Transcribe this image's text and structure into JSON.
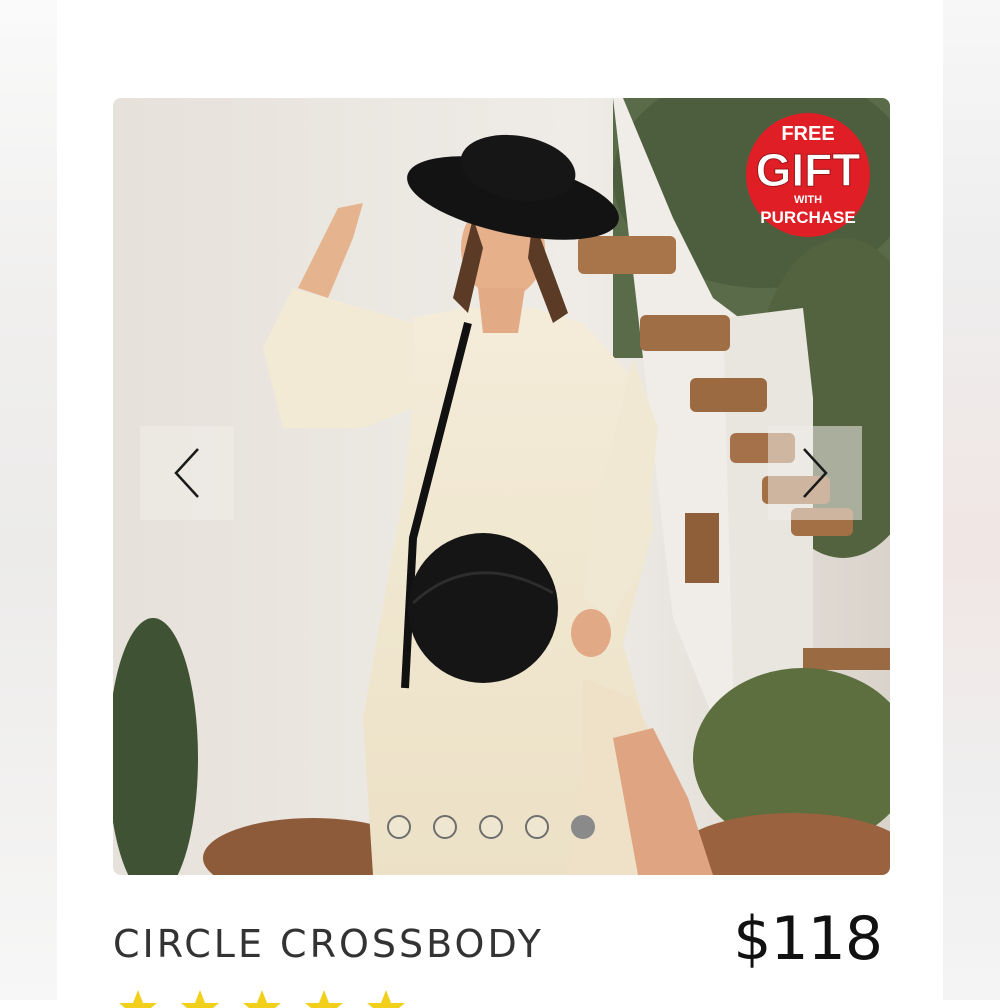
{
  "product": {
    "title": "CIRCLE CROSSBODY",
    "price": "$118",
    "image_alt": "Woman in cream dress and black hat wearing a round black leather crossbody bag",
    "rating_stars": 5
  },
  "badge": {
    "line1": "FREE",
    "line2": "GIFT",
    "line3": "WITH",
    "line4": "PURCHASE"
  },
  "carousel": {
    "slide_count": 5,
    "active_index": 4,
    "prev_icon": "chevron-left-icon",
    "next_icon": "chevron-right-icon"
  },
  "colors": {
    "badge_red": "#e01e25",
    "star_yellow": "#f2cf1b",
    "text_dark": "#333333"
  }
}
